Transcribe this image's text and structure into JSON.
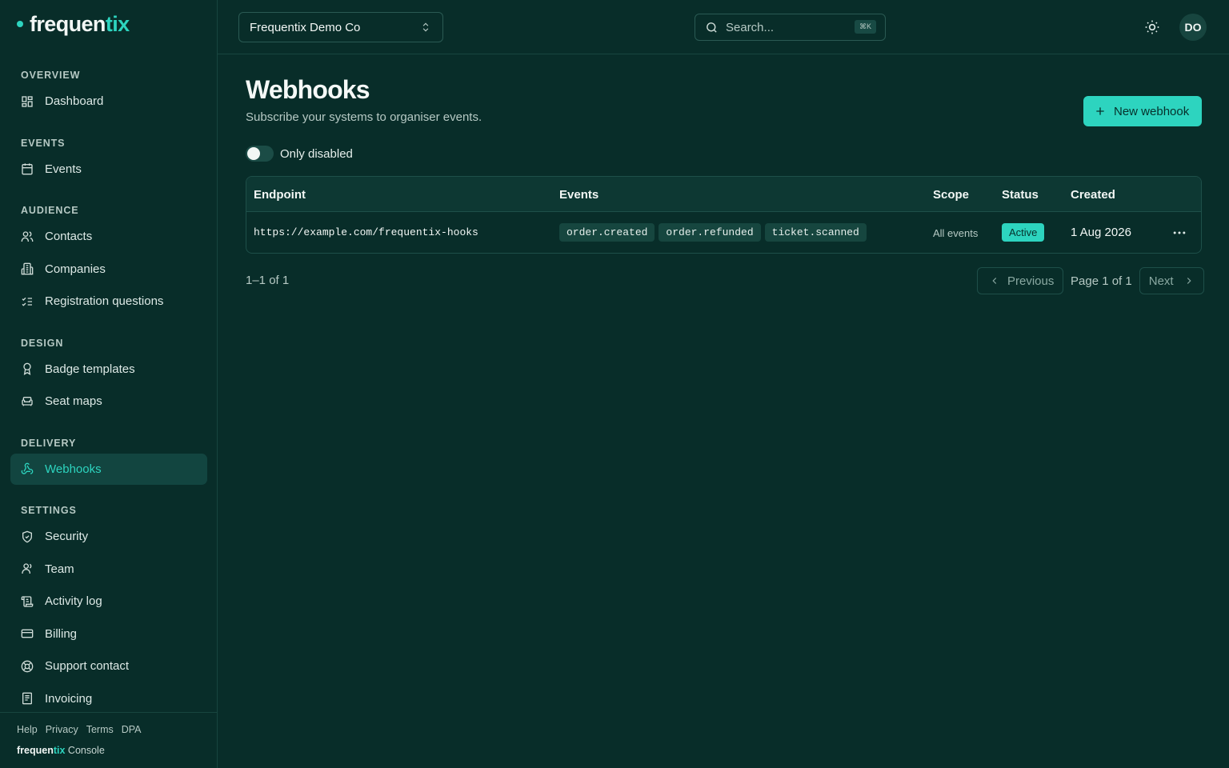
{
  "brand": {
    "name_main": "frequen",
    "name_accent": "tix",
    "accent_color": "#2dd4bf"
  },
  "sidebar": {
    "sections": [
      {
        "title": "OVERVIEW",
        "items": [
          {
            "label": "Dashboard",
            "icon": "dashboard-icon"
          }
        ]
      },
      {
        "title": "EVENTS",
        "items": [
          {
            "label": "Events",
            "icon": "calendar-icon"
          }
        ]
      },
      {
        "title": "AUDIENCE",
        "items": [
          {
            "label": "Contacts",
            "icon": "users-icon"
          },
          {
            "label": "Companies",
            "icon": "building-icon"
          },
          {
            "label": "Registration questions",
            "icon": "list-checks-icon"
          }
        ]
      },
      {
        "title": "DESIGN",
        "items": [
          {
            "label": "Badge templates",
            "icon": "badge-icon"
          },
          {
            "label": "Seat maps",
            "icon": "armchair-icon"
          }
        ]
      },
      {
        "title": "DELIVERY",
        "items": [
          {
            "label": "Webhooks",
            "icon": "webhook-icon",
            "active": true
          }
        ]
      },
      {
        "title": "SETTINGS",
        "items": [
          {
            "label": "Security",
            "icon": "shield-icon"
          },
          {
            "label": "Team",
            "icon": "user-icon"
          },
          {
            "label": "Activity log",
            "icon": "scroll-icon"
          },
          {
            "label": "Billing",
            "icon": "credit-card-icon"
          },
          {
            "label": "Support contact",
            "icon": "life-buoy-icon"
          },
          {
            "label": "Invoicing",
            "icon": "receipt-icon"
          }
        ]
      }
    ],
    "footer": {
      "links": [
        "Help",
        "Privacy",
        "Terms",
        "DPA"
      ],
      "brand_main": "frequen",
      "brand_accent": "tix",
      "brand_suffix": " Console"
    }
  },
  "topbar": {
    "org_name": "Frequentix Demo Co",
    "search_placeholder": "Search...",
    "search_shortcut": "⌘K",
    "avatar_initials": "DO"
  },
  "page": {
    "title": "Webhooks",
    "subtitle": "Subscribe your systems to organiser events.",
    "new_button": "New webhook",
    "filter_toggle": {
      "label": "Only disabled",
      "on": false
    }
  },
  "table": {
    "columns": {
      "endpoint": "Endpoint",
      "events": "Events",
      "scope": "Scope",
      "status": "Status",
      "created": "Created"
    },
    "rows": [
      {
        "endpoint": "https://example.com/frequentix-hooks",
        "events": [
          "order.created",
          "order.refunded",
          "ticket.scanned"
        ],
        "scope": "All events",
        "status": "Active",
        "created": "1 Aug 2026"
      }
    ]
  },
  "pagination": {
    "count": "1–1 of 1",
    "previous": "Previous",
    "page_label": "Page 1 of 1",
    "next": "Next"
  }
}
